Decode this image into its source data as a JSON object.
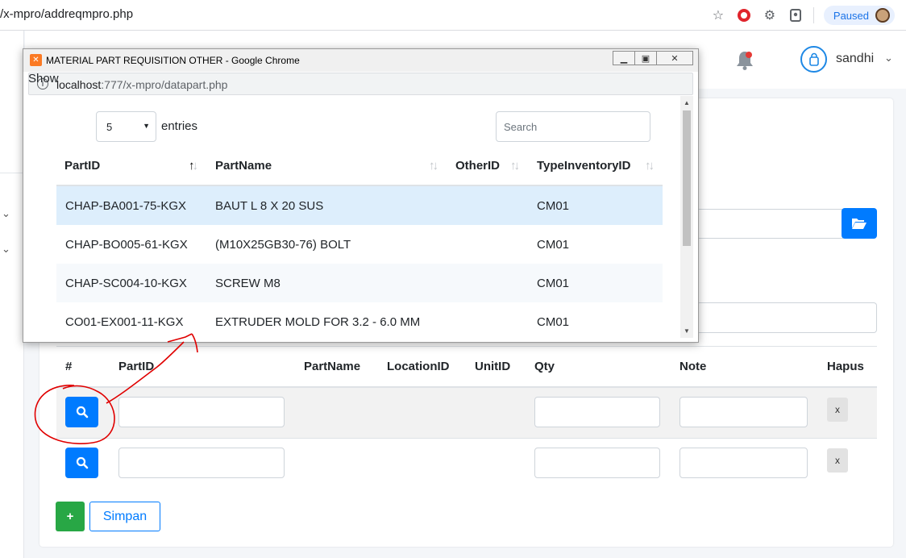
{
  "browser": {
    "url_partial": "/x-mpro/addreqmpro.php",
    "paused_label": "Paused"
  },
  "header": {
    "user_name": "sandhi"
  },
  "table": {
    "headers": [
      "#",
      "PartID",
      "PartName",
      "LocationID",
      "UnitID",
      "Qty",
      "Note",
      "Hapus"
    ],
    "delete_label": "x"
  },
  "actions": {
    "add_label": "+",
    "save_label": "Simpan"
  },
  "popup": {
    "window_title": "MATERIAL PART REQUISITION OTHER - Google Chrome",
    "url_host": "localhost",
    "url_path": ":777/x-mpro/datapart.php",
    "show_label": "Show",
    "entries_value": "5",
    "entries_label": "entries",
    "search_placeholder": "Search",
    "columns": [
      "PartID",
      "PartName",
      "OtherID",
      "TypeInventoryID"
    ],
    "rows": [
      {
        "part_id": "CHAP-BA001-75-KGX",
        "part_name": "BAUT L 8 X 20 SUS",
        "other_id": "",
        "type_inventory_id": "CM01"
      },
      {
        "part_id": "CHAP-BO005-61-KGX",
        "part_name": "(M10X25GB30-76) BOLT",
        "other_id": "",
        "type_inventory_id": "CM01"
      },
      {
        "part_id": "CHAP-SC004-10-KGX",
        "part_name": "SCREW M8",
        "other_id": "",
        "type_inventory_id": "CM01"
      },
      {
        "part_id": "CO01-EX001-11-KGX",
        "part_name": "EXTRUDER MOLD FOR 3.2 - 6.0 MM",
        "other_id": "",
        "type_inventory_id": "CM01"
      }
    ]
  },
  "colors": {
    "primary": "#007bff",
    "success": "#28a745",
    "annotation": "#e00000",
    "selected_row": "#ddeefc"
  }
}
